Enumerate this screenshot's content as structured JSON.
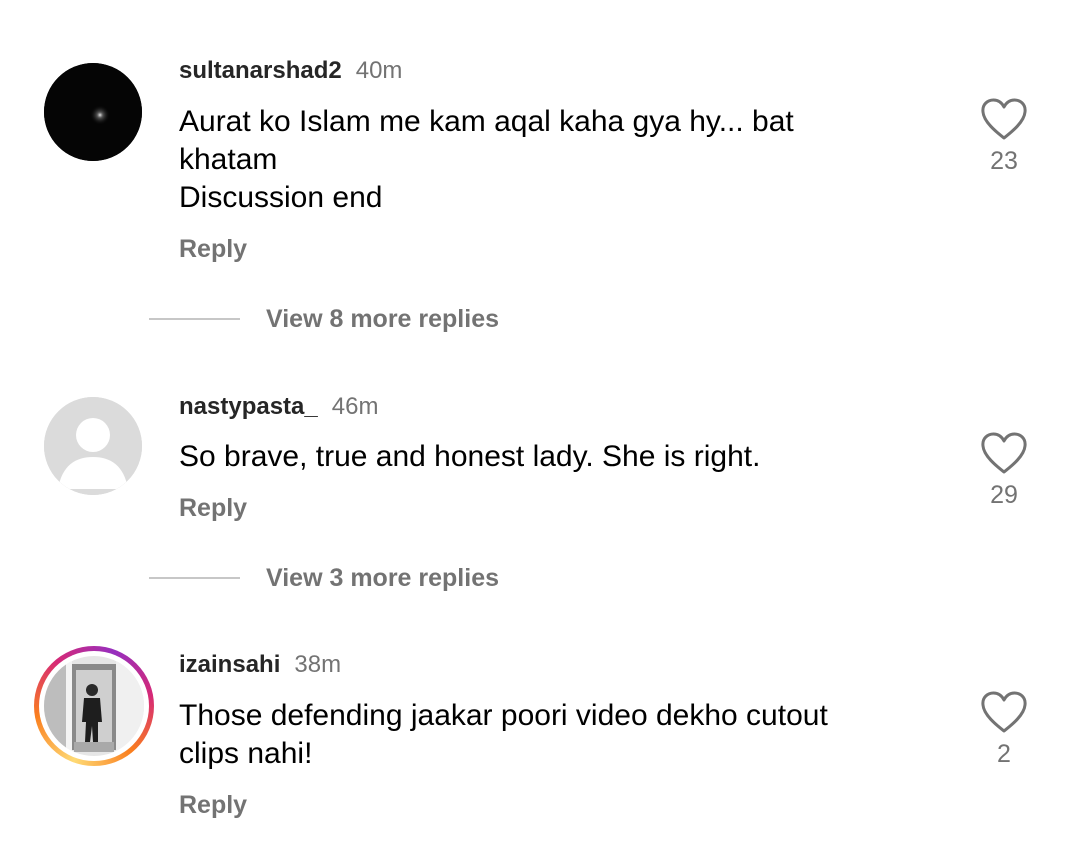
{
  "comments": [
    {
      "username": "sultanarshad2",
      "time": "40m",
      "lines": [
        "Aurat ko Islam me kam aqal kaha gya hy... bat",
        "khatam",
        "Discussion end"
      ],
      "reply_label": "Reply",
      "likes": "23",
      "view_more": "View 8 more replies",
      "avatar": "dark-photo"
    },
    {
      "username": "nastypasta_",
      "time": "46m",
      "lines": [
        "So brave, true and honest lady. She is right."
      ],
      "reply_label": "Reply",
      "likes": "29",
      "view_more": "View 3 more replies",
      "avatar": "default-user-icon"
    },
    {
      "username": "izainsahi",
      "time": "38m",
      "lines": [
        "Those defending jaakar poori video dekho cutout",
        "clips nahi!"
      ],
      "reply_label": "Reply",
      "likes": "2",
      "avatar": "photo-with-story-ring"
    }
  ],
  "colors": {
    "secondary_text": "#737373",
    "username": "#262626",
    "divider": "#c7c7c7",
    "story_ring": [
      "#feda75",
      "#fa7e1e",
      "#d62976",
      "#962fbf"
    ]
  },
  "icons": {
    "like": "heart-outline-icon"
  }
}
